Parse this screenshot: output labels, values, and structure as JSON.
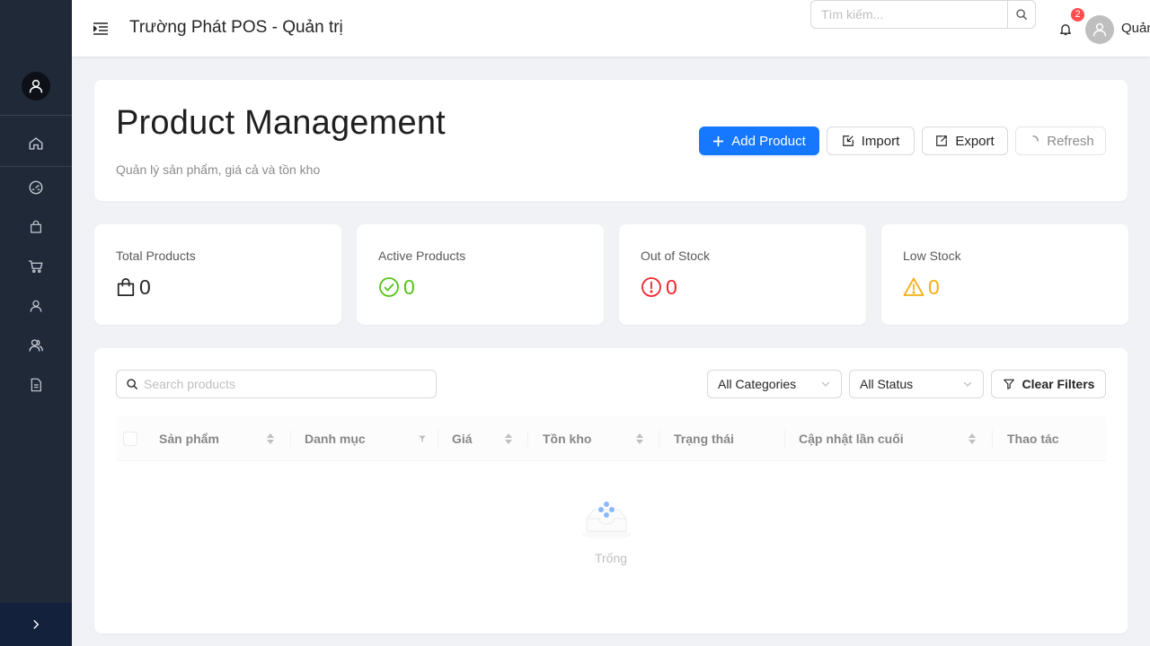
{
  "header": {
    "app_title": "Trường Phát POS - Quản trị",
    "search_placeholder": "Tìm kiếm...",
    "notification_count": "2",
    "user_name": "Quản"
  },
  "sidebar": {
    "items": [
      {
        "icon": "home-icon"
      },
      {
        "icon": "dashboard-icon"
      },
      {
        "icon": "shopping-bag-icon"
      },
      {
        "icon": "cart-icon"
      },
      {
        "icon": "user-icon"
      },
      {
        "icon": "team-icon"
      },
      {
        "icon": "file-icon"
      }
    ],
    "colors": {
      "background": "#1f2937",
      "collapse": "#14213d"
    }
  },
  "page": {
    "title": "Product Management",
    "subtitle": "Quản lý sản phẩm, giá cả và tồn kho",
    "buttons": {
      "add": "Add Product",
      "import": "Import",
      "export": "Export",
      "refresh": "Refresh"
    }
  },
  "stats": [
    {
      "label": "Total Products",
      "value": "0",
      "icon": "shopping-bag-icon",
      "color": "#262626"
    },
    {
      "label": "Active Products",
      "value": "0",
      "icon": "check-circle-icon",
      "color": "#52c41a"
    },
    {
      "label": "Out of Stock",
      "value": "0",
      "icon": "exclamation-circle-icon",
      "color": "#f5222d"
    },
    {
      "label": "Low Stock",
      "value": "0",
      "icon": "warning-icon",
      "color": "#faad14"
    }
  ],
  "table": {
    "search_placeholder": "Search products",
    "category_filter": "All Categories",
    "status_filter": "All Status",
    "clear_filters": "Clear Filters",
    "columns": [
      "Sản phẩm",
      "Danh mục",
      "Giá",
      "Tồn kho",
      "Trạng thái",
      "Cập nhật lần cuối",
      "Thao tác"
    ],
    "empty_text": "Trống"
  },
  "colors": {
    "primary": "#1677ff",
    "success": "#52c41a",
    "danger": "#f5222d",
    "warning": "#faad14"
  }
}
